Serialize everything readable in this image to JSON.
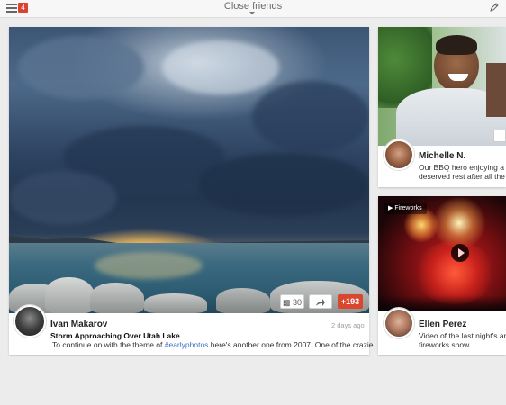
{
  "header": {
    "title": "Close friends",
    "notification_count": "4"
  },
  "posts": [
    {
      "author": "Ivan Makarov",
      "time": "2 days ago",
      "headline": "Storm Approaching Over Utah Lake",
      "text_before": "To continue on with the theme of ",
      "hashtag": "#earlyphotos",
      "text_after": " here's another one from 2007. One of the crazie...",
      "comments": "30",
      "plus": "+193"
    },
    {
      "author": "Michelle N.",
      "line1": "Our BBQ hero enjoying a we",
      "line2": "deserved rest after all the"
    },
    {
      "author": "Ellen Perez",
      "media_label": "Fireworks",
      "line1": "Video of the last night's ama",
      "line2": "fireworks show."
    }
  ],
  "colors": {
    "accent": "#d9472e",
    "link": "#3d72c7"
  }
}
